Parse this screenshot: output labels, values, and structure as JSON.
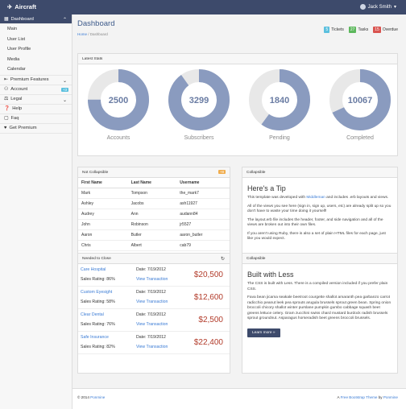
{
  "brand": {
    "name": "Aircraft"
  },
  "user": {
    "name": "Jack Smith"
  },
  "sidebar": {
    "dashboard": "Dashboard",
    "sub": [
      "Main",
      "User List",
      "User Profile",
      "Media",
      "Calendar"
    ],
    "premium_features": "Premium Features",
    "account": "Account",
    "account_badge": "+3",
    "legal": "Legal",
    "help": "Help",
    "faq": "Faq",
    "get_premium": "Get Premium"
  },
  "header": {
    "title": "Dashboard",
    "breadcrumb": [
      "Home",
      "Dashboard"
    ],
    "stats": [
      {
        "count": "5",
        "label": "Tickets",
        "color": "#5bc0de"
      },
      {
        "count": "27",
        "label": "Tasks",
        "color": "#5cb85c"
      },
      {
        "count": "15",
        "label": "Overdue",
        "color": "#d9534f"
      }
    ]
  },
  "latest_stats": {
    "title": "Latest Stats",
    "items": [
      {
        "value": "2500",
        "label": "Accounts",
        "fraction": 0.75
      },
      {
        "value": "3299",
        "label": "Subscribers",
        "fraction": 0.9
      },
      {
        "value": "1840",
        "label": "Pending",
        "fraction": 0.6
      },
      {
        "value": "10067",
        "label": "Completed",
        "fraction": 0.68
      }
    ],
    "ring_color": "#8a9bbf",
    "track_color": "#e8e8e8"
  },
  "collapsible_table": {
    "title": "Not Collapsible",
    "badge": "+8",
    "columns": [
      "First Name",
      "Last Name",
      "Username"
    ],
    "rows": [
      [
        "Mark",
        "Tompson",
        "the_mark7"
      ],
      [
        "Ashley",
        "Jacobs",
        "ash11927"
      ],
      [
        "Audrey",
        "Ann",
        "audann84"
      ],
      [
        "John",
        "Robinson",
        "jr5527"
      ],
      [
        "Aaron",
        "Butler",
        "aaron_butler"
      ],
      [
        "Chris",
        "Albert",
        "cab79"
      ]
    ]
  },
  "tip": {
    "header": "Collapsible",
    "title": "Here's a Tip",
    "p1_a": "This template was developed with ",
    "p1_link": "Middleman",
    "p1_b": " and includes .erb layouts and views.",
    "p2": "All of the views you see here (sign in, sign up, users, etc) are already split up so you don't have to waste your time doing it yourself!",
    "p3": "The layout.erb file includes the header, footer, and side navigation and all of the views are broken out into their own files.",
    "p4": "If you aren't using Ruby, there is also a set of plain HTML files for each page, just like you would expect."
  },
  "deals": {
    "title": "Needed to Close",
    "items": [
      {
        "company": "Care Hospital",
        "rating": "Sales Rating: 86%",
        "date": "Date: 7/19/2012",
        "link": "View Transaction",
        "amount": "$20,500"
      },
      {
        "company": "Custom Eyesight",
        "rating": "Sales Rating: 58%",
        "date": "Date: 7/19/2012",
        "link": "View Transaction",
        "amount": "$12,600"
      },
      {
        "company": "Clear Dental",
        "rating": "Sales Rating: 76%",
        "date": "Date: 7/19/2012",
        "link": "View Transaction",
        "amount": "$2,500"
      },
      {
        "company": "Safe Insurance",
        "rating": "Sales Rating: 82%",
        "date": "Date: 7/19/2012",
        "link": "View Transaction",
        "amount": "$22,400"
      }
    ]
  },
  "less": {
    "header": "Collapsible",
    "title": "Built with Less",
    "p1": "The CSS is built with Less. There is a compiled version included if you prefer plain CSS.",
    "p2": "Fava bean jicama seakale beetroot courgette shallot amaranth pea garbanzo carrot radicchio peanut leek pea sprouts arugula brussels sprout green bean. Spring onion broccoli chicory shallot winter purslane pumpkin gumbo cabbage squash beet greens lettuce celery. Gram zucchini swiss chard mustard burdock radish brussels sprout groundnut. Asparagus horseradish beet greens broccoli brussels.",
    "button": "Learn more »"
  },
  "footer": {
    "left_a": "© 2014 ",
    "left_link": "Ponmine",
    "right_a": "A ",
    "right_link1": "Free Bootstrap Theme",
    "right_b": " by ",
    "right_link2": "Ponmine"
  }
}
